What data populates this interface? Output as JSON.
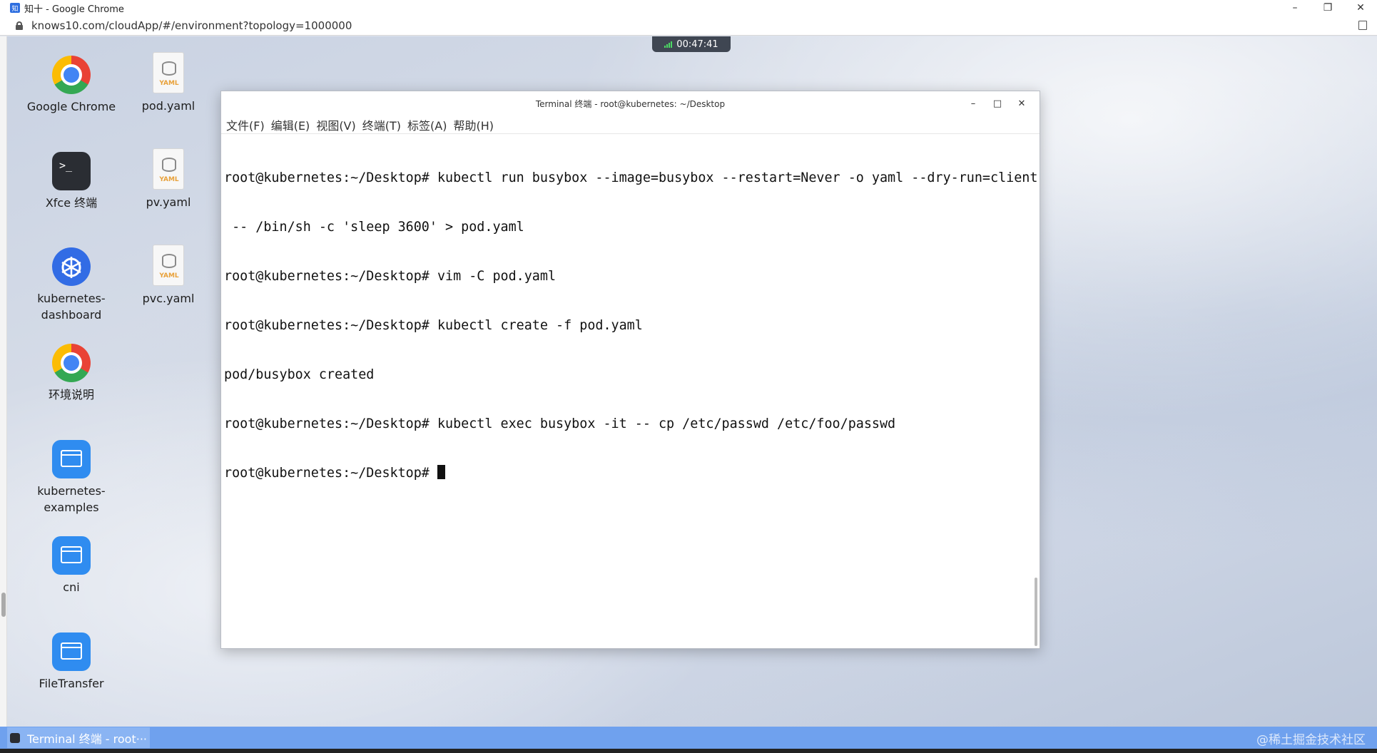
{
  "browser": {
    "window_title": "知十 - Google Chrome",
    "url": "knows10.com/cloudApp/#/environment?topology=1000000",
    "controls": {
      "minimize": "–",
      "restore": "❐",
      "close": "✕"
    }
  },
  "session": {
    "timer": "00:47:41"
  },
  "desktop": {
    "icons": [
      {
        "label": "Google Chrome",
        "icon": "chrome-icon"
      },
      {
        "label": "pod.yaml",
        "icon": "yaml-file-icon"
      },
      {
        "label": "Xfce 终端",
        "icon": "terminal-icon"
      },
      {
        "label": "pv.yaml",
        "icon": "yaml-file-icon"
      },
      {
        "label": "kubernetes-\ndashboard",
        "icon": "kubernetes-icon"
      },
      {
        "label": "pvc.yaml",
        "icon": "yaml-file-icon"
      },
      {
        "label": "环境说明",
        "icon": "chrome-icon"
      },
      {
        "label": "kubernetes-\nexamples",
        "icon": "folder-icon"
      },
      {
        "label": "cni",
        "icon": "folder-icon"
      },
      {
        "label": "FileTransfer",
        "icon": "folder-icon"
      }
    ],
    "yaml_badge": "YAML"
  },
  "terminal": {
    "title": "Terminal 终端 - root@kubernetes: ~/Desktop",
    "menu": [
      "文件(F)",
      "编辑(E)",
      "视图(V)",
      "终端(T)",
      "标签(A)",
      "帮助(H)"
    ],
    "controls": {
      "minimize": "–",
      "maximize": "□",
      "close": "✕"
    },
    "lines": [
      "root@kubernetes:~/Desktop# kubectl run busybox --image=busybox --restart=Never -o yaml --dry-run=client",
      " -- /bin/sh -c 'sleep 3600' > pod.yaml",
      "root@kubernetes:~/Desktop# vim -C pod.yaml",
      "root@kubernetes:~/Desktop# kubectl create -f pod.yaml",
      "pod/busybox created",
      "root@kubernetes:~/Desktop# kubectl exec busybox -it -- cp /etc/passwd /etc/foo/passwd"
    ],
    "prompt": "root@kubernetes:~/Desktop# "
  },
  "taskbar": {
    "item_label": "Terminal 终端 - root···",
    "watermark": "@稀土掘金技术社区"
  }
}
